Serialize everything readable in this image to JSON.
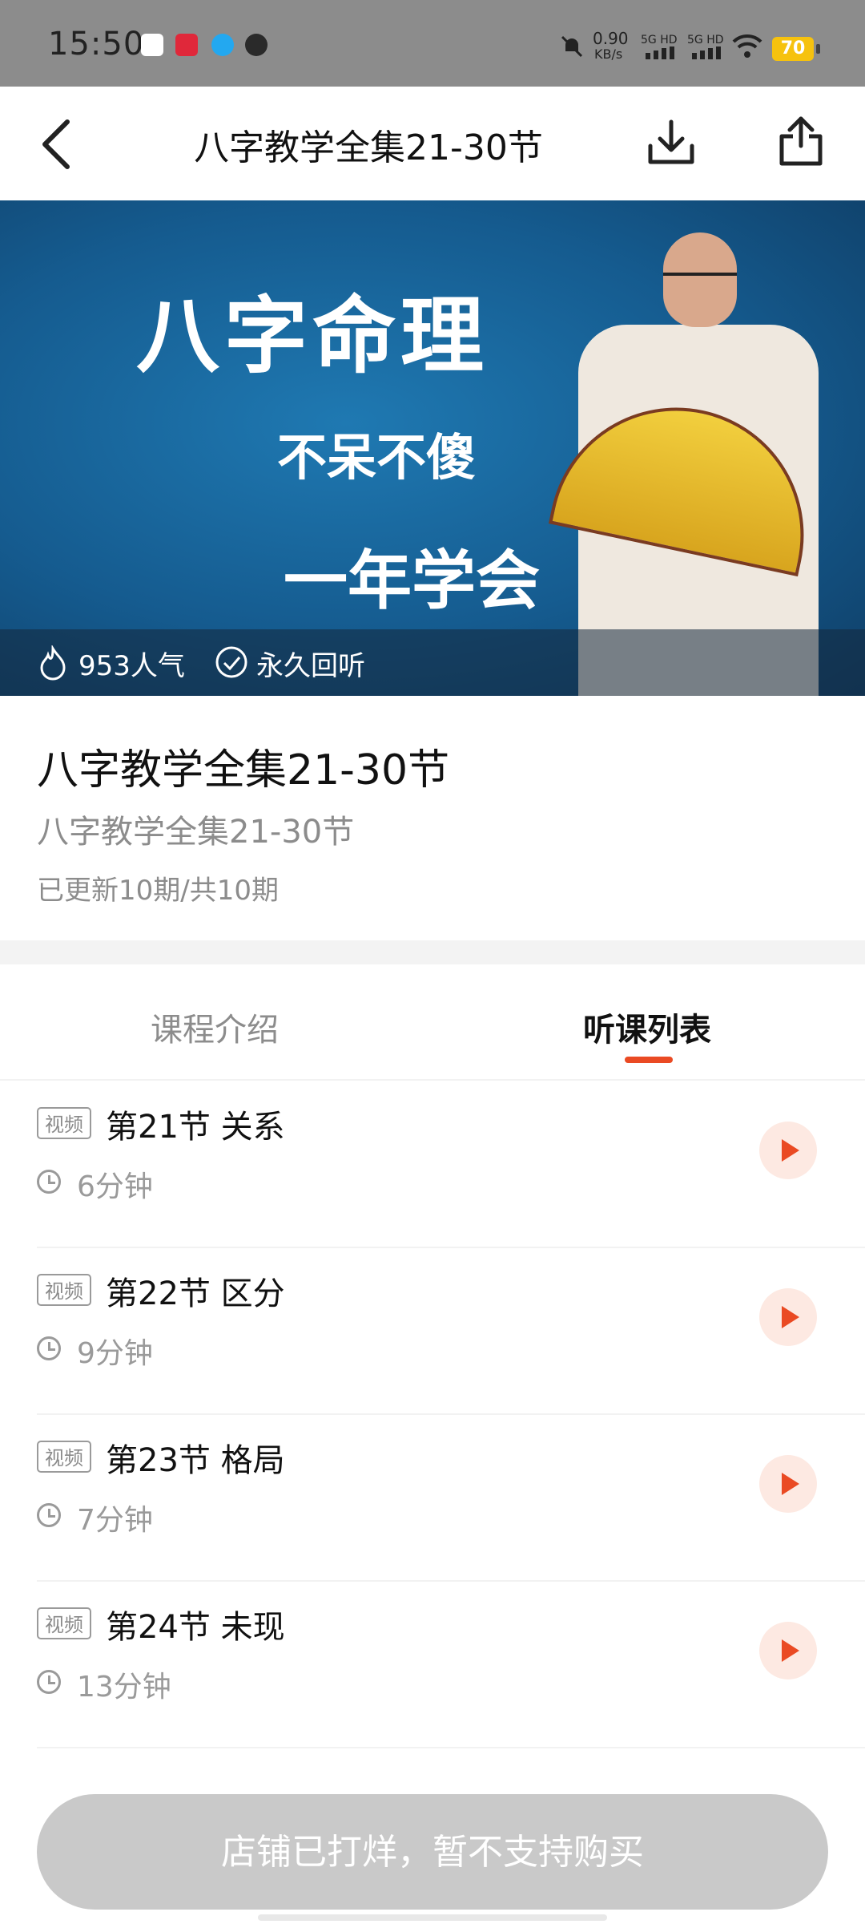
{
  "status_bar": {
    "time": "15:50",
    "net_speed": "0.90",
    "net_unit": "KB/s",
    "sig1": "5G HD",
    "sig2": "5G HD",
    "battery": "70"
  },
  "nav": {
    "title": "八字教学全集21-30节"
  },
  "hero": {
    "line1": "八字命理",
    "line2": "不呆不傻",
    "line3": "一年学会",
    "popularity": "953人气",
    "replay": "永久回听"
  },
  "course": {
    "title": "八字教学全集21-30节",
    "subtitle": "八字教学全集21-30节",
    "updated": "已更新10期/共10期"
  },
  "tabs": {
    "intro": "课程介绍",
    "list": "听课列表"
  },
  "lessons": [
    {
      "tag": "视频",
      "title": "第21节 关系",
      "duration": "6分钟"
    },
    {
      "tag": "视频",
      "title": "第22节 区分",
      "duration": "9分钟"
    },
    {
      "tag": "视频",
      "title": "第23节 格局",
      "duration": "7分钟"
    },
    {
      "tag": "视频",
      "title": "第24节 未现",
      "duration": "13分钟"
    }
  ],
  "buy_button": "店铺已打烊，暂不支持购买",
  "colors": {
    "accent": "#ea4a23",
    "button_disabled": "#c9c9c9"
  }
}
